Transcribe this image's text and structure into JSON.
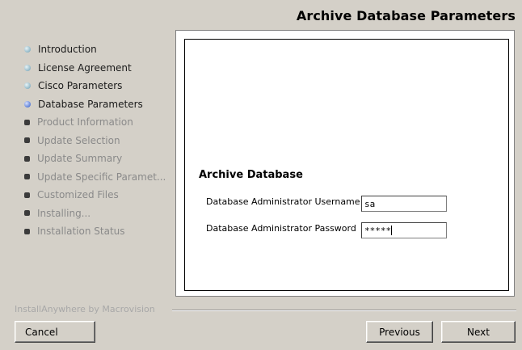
{
  "header": {
    "title": "Archive Database Parameters"
  },
  "steps": [
    {
      "label": "Introduction",
      "state": "done"
    },
    {
      "label": "License Agreement",
      "state": "done"
    },
    {
      "label": "Cisco Parameters",
      "state": "done"
    },
    {
      "label": "Database Parameters",
      "state": "current"
    },
    {
      "label": "Product Information",
      "state": "pending"
    },
    {
      "label": "Update Selection",
      "state": "pending"
    },
    {
      "label": "Update Summary",
      "state": "pending"
    },
    {
      "label": "Update Specific Paramet...",
      "state": "pending"
    },
    {
      "label": "Customized Files",
      "state": "pending"
    },
    {
      "label": "Installing...",
      "state": "pending"
    },
    {
      "label": "Installation Status",
      "state": "pending"
    }
  ],
  "form": {
    "section_title": "Archive Database",
    "username_label": "Database Administrator Username",
    "username_value": "sa",
    "password_label": "Database Administrator Password",
    "password_value": "*****"
  },
  "footer": {
    "brand": "InstallAnywhere by Macrovision",
    "cancel_label": "Cancel",
    "previous_label": "Previous",
    "next_label": "Next"
  },
  "colors": {
    "window_bg": "#d4d0c8",
    "done_bullet": "#8fb6c6",
    "current_bullet": "#5c7fd6",
    "pending_bullet": "#3b3b3b",
    "pending_text": "#8a8a8a"
  }
}
